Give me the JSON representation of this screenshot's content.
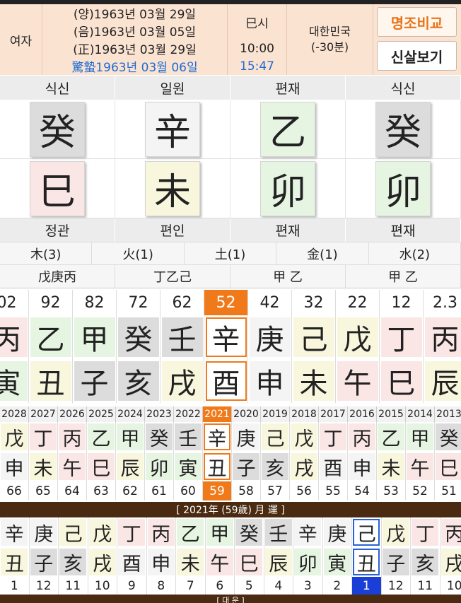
{
  "header": {
    "gender": "여자",
    "date_lines": [
      "(양)1963년 03월 29일",
      "(음)1963년 03월 05일",
      "(正)1963년 03월 29일",
      "驚蟄1963년 03월 06일"
    ],
    "time_lines": [
      "巳시",
      "10:00",
      "15:47"
    ],
    "location": "대한민국",
    "offset": "(-30분)",
    "compare_button": "명조비교",
    "shinsal_button": "신살보기"
  },
  "pillars": {
    "top_labels": [
      "식신",
      "일원",
      "편재",
      "식신"
    ],
    "stems": [
      {
        "char": "癸",
        "el": "water"
      },
      {
        "char": "辛",
        "el": "metal"
      },
      {
        "char": "乙",
        "el": "wood"
      },
      {
        "char": "癸",
        "el": "water"
      }
    ],
    "branches": [
      {
        "char": "巳",
        "el": "fire"
      },
      {
        "char": "未",
        "el": "earth"
      },
      {
        "char": "卯",
        "el": "wood"
      },
      {
        "char": "卯",
        "el": "wood"
      }
    ],
    "bottom_labels": [
      "정관",
      "편인",
      "편재",
      "편재"
    ]
  },
  "elements": [
    "木(3)",
    "火(1)",
    "土(1)",
    "金(1)",
    "水(2)"
  ],
  "hidden_stems": [
    "戊庚丙",
    "丁乙己",
    "甲 乙",
    "甲 乙"
  ],
  "daeun": {
    "ages": [
      "02",
      "92",
      "82",
      "72",
      "62",
      "52",
      "42",
      "32",
      "22",
      "12",
      "2.3"
    ],
    "selected_index": 5,
    "stems": [
      {
        "char": "丙",
        "el": "fire"
      },
      {
        "char": "乙",
        "el": "wood"
      },
      {
        "char": "甲",
        "el": "wood"
      },
      {
        "char": "癸",
        "el": "water"
      },
      {
        "char": "壬",
        "el": "water"
      },
      {
        "char": "辛",
        "el": "metal"
      },
      {
        "char": "庚",
        "el": "metal"
      },
      {
        "char": "己",
        "el": "earth"
      },
      {
        "char": "戊",
        "el": "earth"
      },
      {
        "char": "丁",
        "el": "fire"
      },
      {
        "char": "丙",
        "el": "fire"
      }
    ],
    "branches": [
      {
        "char": "寅",
        "el": "wood"
      },
      {
        "char": "丑",
        "el": "earth"
      },
      {
        "char": "子",
        "el": "water"
      },
      {
        "char": "亥",
        "el": "water"
      },
      {
        "char": "戌",
        "el": "earth"
      },
      {
        "char": "酉",
        "el": "metal"
      },
      {
        "char": "申",
        "el": "metal"
      },
      {
        "char": "未",
        "el": "earth"
      },
      {
        "char": "午",
        "el": "fire"
      },
      {
        "char": "巳",
        "el": "fire"
      },
      {
        "char": "辰",
        "el": "earth"
      }
    ]
  },
  "yearly": {
    "years": [
      "2028",
      "2027",
      "2026",
      "2025",
      "2024",
      "2023",
      "2022",
      "2021",
      "2020",
      "2019",
      "2018",
      "2017",
      "2016",
      "2015",
      "2014",
      "2013"
    ],
    "selected_index": 7,
    "stems": [
      {
        "char": "戊",
        "el": "earth"
      },
      {
        "char": "丁",
        "el": "fire"
      },
      {
        "char": "丙",
        "el": "fire"
      },
      {
        "char": "乙",
        "el": "wood"
      },
      {
        "char": "甲",
        "el": "wood"
      },
      {
        "char": "癸",
        "el": "water"
      },
      {
        "char": "壬",
        "el": "water"
      },
      {
        "char": "辛",
        "el": "metal"
      },
      {
        "char": "庚",
        "el": "metal"
      },
      {
        "char": "己",
        "el": "earth"
      },
      {
        "char": "戊",
        "el": "earth"
      },
      {
        "char": "丁",
        "el": "fire"
      },
      {
        "char": "丙",
        "el": "fire"
      },
      {
        "char": "乙",
        "el": "wood"
      },
      {
        "char": "甲",
        "el": "wood"
      },
      {
        "char": "癸",
        "el": "water"
      }
    ],
    "branches": [
      {
        "char": "申",
        "el": "metal"
      },
      {
        "char": "未",
        "el": "earth"
      },
      {
        "char": "午",
        "el": "fire"
      },
      {
        "char": "巳",
        "el": "fire"
      },
      {
        "char": "辰",
        "el": "earth"
      },
      {
        "char": "卯",
        "el": "wood"
      },
      {
        "char": "寅",
        "el": "wood"
      },
      {
        "char": "丑",
        "el": "earth"
      },
      {
        "char": "子",
        "el": "water"
      },
      {
        "char": "亥",
        "el": "water"
      },
      {
        "char": "戌",
        "el": "earth"
      },
      {
        "char": "酉",
        "el": "metal"
      },
      {
        "char": "申",
        "el": "metal"
      },
      {
        "char": "未",
        "el": "earth"
      },
      {
        "char": "午",
        "el": "fire"
      },
      {
        "char": "巳",
        "el": "fire"
      }
    ],
    "ages": [
      "66",
      "65",
      "64",
      "63",
      "62",
      "61",
      "60",
      "59",
      "58",
      "57",
      "56",
      "55",
      "54",
      "53",
      "52",
      "51"
    ]
  },
  "monthly": {
    "title": "[ 2021年 (59歲) 月 運 ]",
    "selected_index": 12,
    "stems": [
      {
        "char": "辛",
        "el": "metal"
      },
      {
        "char": "庚",
        "el": "metal"
      },
      {
        "char": "己",
        "el": "earth"
      },
      {
        "char": "戊",
        "el": "earth"
      },
      {
        "char": "丁",
        "el": "fire"
      },
      {
        "char": "丙",
        "el": "fire"
      },
      {
        "char": "乙",
        "el": "wood"
      },
      {
        "char": "甲",
        "el": "wood"
      },
      {
        "char": "癸",
        "el": "water"
      },
      {
        "char": "壬",
        "el": "water"
      },
      {
        "char": "辛",
        "el": "metal"
      },
      {
        "char": "庚",
        "el": "metal"
      },
      {
        "char": "己",
        "el": "earth"
      },
      {
        "char": "戊",
        "el": "earth"
      },
      {
        "char": "丁",
        "el": "fire"
      },
      {
        "char": "丙",
        "el": "fire"
      }
    ],
    "branches": [
      {
        "char": "丑",
        "el": "earth"
      },
      {
        "char": "子",
        "el": "water"
      },
      {
        "char": "亥",
        "el": "water"
      },
      {
        "char": "戌",
        "el": "earth"
      },
      {
        "char": "酉",
        "el": "metal"
      },
      {
        "char": "申",
        "el": "metal"
      },
      {
        "char": "未",
        "el": "earth"
      },
      {
        "char": "午",
        "el": "fire"
      },
      {
        "char": "巳",
        "el": "fire"
      },
      {
        "char": "辰",
        "el": "earth"
      },
      {
        "char": "卯",
        "el": "wood"
      },
      {
        "char": "寅",
        "el": "wood"
      },
      {
        "char": "丑",
        "el": "earth"
      },
      {
        "char": "子",
        "el": "water"
      },
      {
        "char": "亥",
        "el": "water"
      },
      {
        "char": "戌",
        "el": "earth"
      }
    ],
    "months": [
      "1",
      "12",
      "11",
      "10",
      "9",
      "8",
      "7",
      "6",
      "5",
      "4",
      "3",
      "2",
      "1",
      "12",
      "11",
      "10"
    ]
  },
  "footer_text": "[ 대 운 ]"
}
